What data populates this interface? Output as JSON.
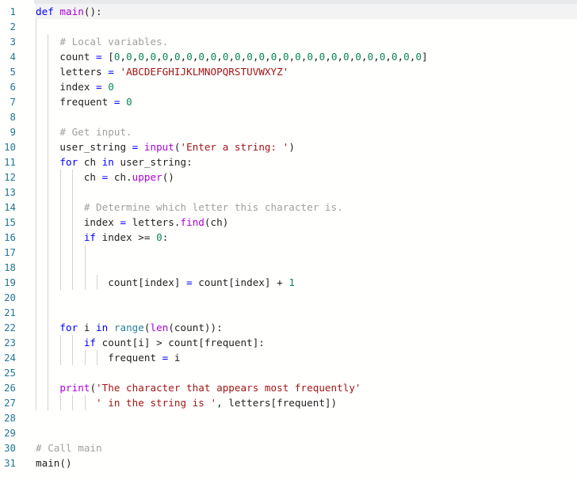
{
  "editor": {
    "language": "python",
    "current_line": 1,
    "colors": {
      "keyword": "#0000ff",
      "function": "#af00db",
      "builtin_class": "#267f99",
      "string": "#a31515",
      "number": "#098658",
      "comment": "#a0a0a0",
      "operator": "#0000ff",
      "plain": "#1f1f1f",
      "line_number": "#237893",
      "indent_guide": "#d3d3d3",
      "current_line_bg": "#f3f3f3",
      "top_bar_bg": "#e8e9eb"
    },
    "lines": [
      {
        "number": "1",
        "indent": "",
        "guides": 0,
        "tokens": [
          [
            "keyword",
            "def"
          ],
          [
            "plain",
            " "
          ],
          [
            "function",
            "main"
          ],
          [
            "plain",
            "():"
          ]
        ]
      },
      {
        "number": "2",
        "indent": "",
        "guides": 1,
        "tokens": []
      },
      {
        "number": "3",
        "indent": "    ",
        "guides": 2,
        "tokens": [
          [
            "comment",
            "# Local variables."
          ]
        ]
      },
      {
        "number": "4",
        "indent": "    ",
        "guides": 2,
        "tokens": [
          [
            "plain",
            "count "
          ],
          [
            "operator",
            "="
          ],
          [
            "plain",
            " ["
          ],
          [
            "number",
            "0"
          ],
          [
            "plain",
            ","
          ],
          [
            "number",
            "0"
          ],
          [
            "plain",
            ","
          ],
          [
            "number",
            "0"
          ],
          [
            "plain",
            ","
          ],
          [
            "number",
            "0"
          ],
          [
            "plain",
            ","
          ],
          [
            "number",
            "0"
          ],
          [
            "plain",
            ","
          ],
          [
            "number",
            "0"
          ],
          [
            "plain",
            ","
          ],
          [
            "number",
            "0"
          ],
          [
            "plain",
            ","
          ],
          [
            "number",
            "0"
          ],
          [
            "plain",
            ","
          ],
          [
            "number",
            "0"
          ],
          [
            "plain",
            ","
          ],
          [
            "number",
            "0"
          ],
          [
            "plain",
            ","
          ],
          [
            "number",
            "0"
          ],
          [
            "plain",
            ","
          ],
          [
            "number",
            "0"
          ],
          [
            "plain",
            ","
          ],
          [
            "number",
            "0"
          ],
          [
            "plain",
            ","
          ],
          [
            "number",
            "0"
          ],
          [
            "plain",
            ","
          ],
          [
            "number",
            "0"
          ],
          [
            "plain",
            ","
          ],
          [
            "number",
            "0"
          ],
          [
            "plain",
            ","
          ],
          [
            "number",
            "0"
          ],
          [
            "plain",
            ","
          ],
          [
            "number",
            "0"
          ],
          [
            "plain",
            ","
          ],
          [
            "number",
            "0"
          ],
          [
            "plain",
            ","
          ],
          [
            "number",
            "0"
          ],
          [
            "plain",
            ","
          ],
          [
            "number",
            "0"
          ],
          [
            "plain",
            ","
          ],
          [
            "number",
            "0"
          ],
          [
            "plain",
            ","
          ],
          [
            "number",
            "0"
          ],
          [
            "plain",
            ","
          ],
          [
            "number",
            "0"
          ],
          [
            "plain",
            ","
          ],
          [
            "number",
            "0"
          ],
          [
            "plain",
            ","
          ],
          [
            "number",
            "0"
          ],
          [
            "plain",
            "]"
          ]
        ]
      },
      {
        "number": "5",
        "indent": "    ",
        "guides": 2,
        "tokens": [
          [
            "plain",
            "letters "
          ],
          [
            "operator",
            "="
          ],
          [
            "plain",
            " "
          ],
          [
            "string",
            "'ABCDEFGHIJKLMNOPQRSTUVWXYZ'"
          ]
        ]
      },
      {
        "number": "6",
        "indent": "    ",
        "guides": 2,
        "tokens": [
          [
            "plain",
            "index "
          ],
          [
            "operator",
            "="
          ],
          [
            "plain",
            " "
          ],
          [
            "number",
            "0"
          ]
        ]
      },
      {
        "number": "7",
        "indent": "    ",
        "guides": 2,
        "tokens": [
          [
            "plain",
            "frequent "
          ],
          [
            "operator",
            "="
          ],
          [
            "plain",
            " "
          ],
          [
            "number",
            "0"
          ]
        ]
      },
      {
        "number": "8",
        "indent": "",
        "guides": 2,
        "tokens": []
      },
      {
        "number": "9",
        "indent": "    ",
        "guides": 2,
        "tokens": [
          [
            "comment",
            "# Get input."
          ]
        ]
      },
      {
        "number": "10",
        "indent": "    ",
        "guides": 2,
        "tokens": [
          [
            "plain",
            "user_string "
          ],
          [
            "operator",
            "="
          ],
          [
            "plain",
            " "
          ],
          [
            "function",
            "input"
          ],
          [
            "plain",
            "("
          ],
          [
            "string",
            "'Enter a string: '"
          ],
          [
            "plain",
            ")"
          ]
        ]
      },
      {
        "number": "11",
        "indent": "    ",
        "guides": 2,
        "tokens": [
          [
            "keyword",
            "for"
          ],
          [
            "plain",
            " ch "
          ],
          [
            "keyword",
            "in"
          ],
          [
            "plain",
            " user_string:"
          ]
        ]
      },
      {
        "number": "12",
        "indent": "        ",
        "guides": 4,
        "tokens": [
          [
            "plain",
            "ch "
          ],
          [
            "operator",
            "="
          ],
          [
            "plain",
            " ch."
          ],
          [
            "function",
            "upper"
          ],
          [
            "plain",
            "()"
          ]
        ]
      },
      {
        "number": "13",
        "indent": "",
        "guides": 4,
        "tokens": []
      },
      {
        "number": "14",
        "indent": "        ",
        "guides": 4,
        "tokens": [
          [
            "comment",
            "# Determine which letter this character is."
          ]
        ]
      },
      {
        "number": "15",
        "indent": "        ",
        "guides": 4,
        "tokens": [
          [
            "plain",
            "index "
          ],
          [
            "operator",
            "="
          ],
          [
            "plain",
            " letters."
          ],
          [
            "function",
            "find"
          ],
          [
            "plain",
            "(ch)"
          ]
        ]
      },
      {
        "number": "16",
        "indent": "        ",
        "guides": 4,
        "tokens": [
          [
            "keyword",
            "if"
          ],
          [
            "plain",
            " index >= "
          ],
          [
            "number",
            "0"
          ],
          [
            "plain",
            ":"
          ]
        ]
      },
      {
        "number": "17",
        "indent": "",
        "guides": 5,
        "tokens": []
      },
      {
        "number": "18",
        "indent": "",
        "guides": 5,
        "tokens": []
      },
      {
        "number": "19",
        "indent": "            ",
        "guides": 6,
        "tokens": [
          [
            "plain",
            "count[index] "
          ],
          [
            "operator",
            "="
          ],
          [
            "plain",
            " count[index] + "
          ],
          [
            "number",
            "1"
          ]
        ]
      },
      {
        "number": "20",
        "indent": "",
        "guides": 2,
        "tokens": []
      },
      {
        "number": "21",
        "indent": "",
        "guides": 2,
        "tokens": []
      },
      {
        "number": "22",
        "indent": "    ",
        "guides": 2,
        "tokens": [
          [
            "keyword",
            "for"
          ],
          [
            "plain",
            " i "
          ],
          [
            "keyword",
            "in"
          ],
          [
            "plain",
            " "
          ],
          [
            "builtin-class",
            "range"
          ],
          [
            "plain",
            "("
          ],
          [
            "function",
            "len"
          ],
          [
            "plain",
            "(count)):"
          ]
        ]
      },
      {
        "number": "23",
        "indent": "        ",
        "guides": 4,
        "tokens": [
          [
            "keyword",
            "if"
          ],
          [
            "plain",
            " count[i] > count[frequent]:"
          ]
        ]
      },
      {
        "number": "24",
        "indent": "            ",
        "guides": 6,
        "tokens": [
          [
            "plain",
            "frequent "
          ],
          [
            "operator",
            "="
          ],
          [
            "plain",
            " i"
          ]
        ]
      },
      {
        "number": "25",
        "indent": "",
        "guides": 2,
        "tokens": []
      },
      {
        "number": "26",
        "indent": "    ",
        "guides": 2,
        "tokens": [
          [
            "function",
            "print"
          ],
          [
            "plain",
            "("
          ],
          [
            "string",
            "'The character that appears most frequently'"
          ]
        ]
      },
      {
        "number": "27",
        "indent": "          ",
        "guides": 5,
        "tokens": [
          [
            "string",
            "' in the string is '"
          ],
          [
            "plain",
            ", letters[frequent])"
          ]
        ]
      },
      {
        "number": "28",
        "indent": "",
        "guides": 0,
        "tokens": []
      },
      {
        "number": "29",
        "indent": "",
        "guides": 0,
        "tokens": []
      },
      {
        "number": "30",
        "indent": "",
        "guides": 0,
        "tokens": [
          [
            "comment",
            "# Call main"
          ]
        ]
      },
      {
        "number": "31",
        "indent": "",
        "guides": 0,
        "tokens": [
          [
            "plain",
            "main()"
          ]
        ]
      }
    ]
  }
}
